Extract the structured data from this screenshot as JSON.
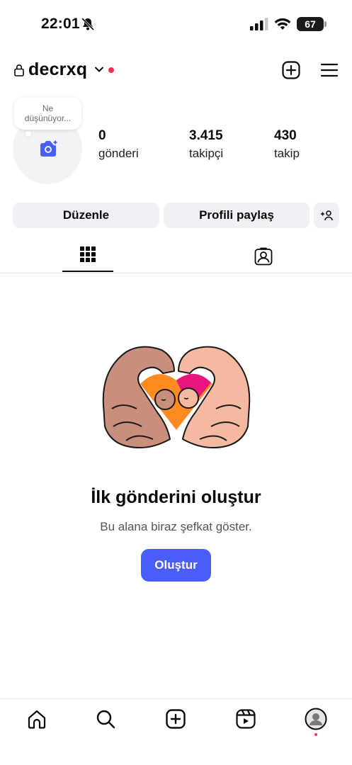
{
  "status_bar": {
    "time": "22:01",
    "battery": "67"
  },
  "header": {
    "username": "decrxq"
  },
  "profile": {
    "note_line1": "Ne",
    "note_line2": "düşünüyor...",
    "stats": {
      "posts_count": "0",
      "posts_label": "gönderi",
      "followers_count": "3.415",
      "followers_label": "takipçi",
      "following_count": "430",
      "following_label": "takip"
    }
  },
  "actions": {
    "edit_label": "Düzenle",
    "share_label": "Profili paylaş"
  },
  "empty_state": {
    "title": "İlk gönderini oluştur",
    "subtitle": "Bu alana biraz şefkat göster.",
    "button_label": "Oluştur"
  },
  "colors": {
    "accent": "#4a5df9",
    "notification": "#ff2d55"
  },
  "icons": {
    "status": [
      "bell-off-icon",
      "signal-icon",
      "wifi-icon",
      "battery-icon"
    ],
    "header": [
      "lock-icon",
      "chevron-down-icon",
      "add-post-icon",
      "menu-icon"
    ],
    "tabs": [
      "grid-icon",
      "tagged-icon"
    ],
    "nav": [
      "home-icon",
      "search-icon",
      "create-icon",
      "reels-icon",
      "profile-icon"
    ]
  }
}
